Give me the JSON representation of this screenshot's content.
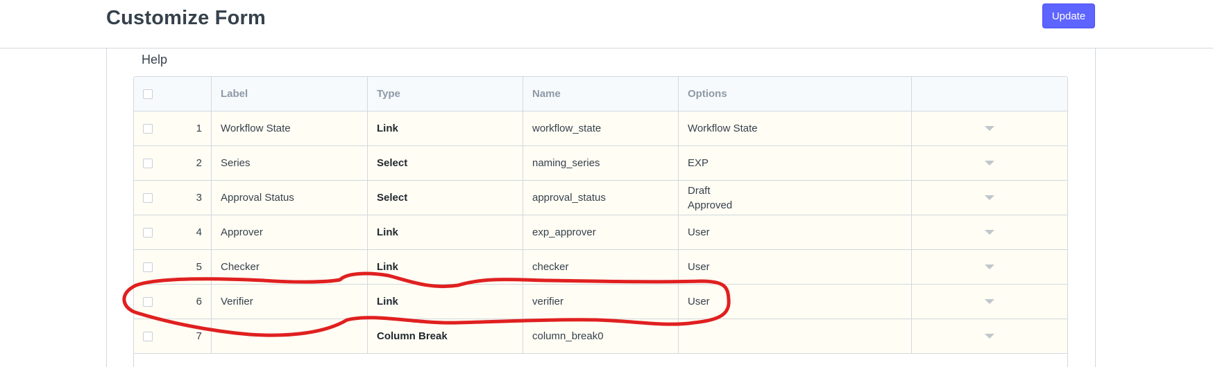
{
  "page": {
    "title": "Customize Form",
    "update_label": "Update",
    "section_label": "Help"
  },
  "grid": {
    "columns": [
      "Label",
      "Type",
      "Name",
      "Options"
    ],
    "rows": [
      {
        "idx": "1",
        "label": "Workflow State",
        "type": "Link",
        "name": "workflow_state",
        "options": [
          "Workflow State"
        ]
      },
      {
        "idx": "2",
        "label": "Series",
        "type": "Select",
        "name": "naming_series",
        "options": [
          "EXP"
        ]
      },
      {
        "idx": "3",
        "label": "Approval Status",
        "type": "Select",
        "name": "approval_status",
        "options": [
          "Draft",
          "Approved"
        ]
      },
      {
        "idx": "4",
        "label": "Approver",
        "type": "Link",
        "name": "exp_approver",
        "options": [
          "User"
        ]
      },
      {
        "idx": "5",
        "label": "Checker",
        "type": "Link",
        "name": "checker",
        "options": [
          "User"
        ]
      },
      {
        "idx": "6",
        "label": "Verifier",
        "type": "Link",
        "name": "verifier",
        "options": [
          "User"
        ]
      },
      {
        "idx": "7",
        "label": "",
        "type": "Column Break",
        "name": "column_break0",
        "options": []
      }
    ]
  },
  "colors": {
    "primary": "#5e64ff",
    "annotation": "#e02020",
    "row_bg": "#fffdf4",
    "header_bg": "#f7fafc"
  },
  "icons": {
    "row_edit": "caret-down-icon",
    "select": "checkbox-icon"
  }
}
